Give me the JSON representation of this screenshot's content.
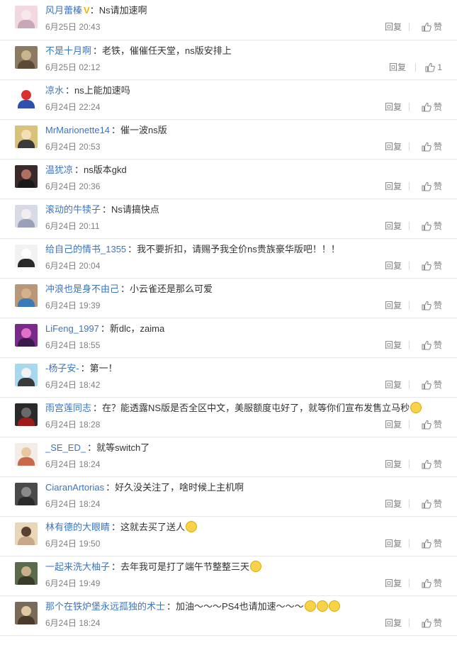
{
  "comments": [
    {
      "user": "风月蕾榛",
      "badge": "V",
      "text": "：Ns请加速啊",
      "emoji": 0,
      "time": "6月25日 20:43",
      "reply": "回复",
      "like": "赞",
      "wide": false,
      "avatar": [
        "#f3d8e0",
        "#f7e8ee",
        "#c8a8b8"
      ]
    },
    {
      "user": "不是十月啊",
      "badge": "",
      "text": "：老铁，催催任天堂，ns版安排上",
      "emoji": 0,
      "time": "6月25日 02:12",
      "reply": "回复",
      "like": "1",
      "wide": true,
      "avatar": [
        "#8c7a62",
        "#c9b58d",
        "#5c4a38"
      ]
    },
    {
      "user": "凉水",
      "badge": "",
      "text": "：ns上能加速吗",
      "emoji": 0,
      "time": "6月24日 22:24",
      "reply": "回复",
      "like": "赞",
      "wide": false,
      "avatar": [
        "#ffffff",
        "#d93030",
        "#3050b0"
      ]
    },
    {
      "user": "MrMarionette14",
      "badge": "",
      "text": "：催一波ns版",
      "emoji": 0,
      "time": "6月24日 20:53",
      "reply": "回复",
      "like": "赞",
      "wide": false,
      "avatar": [
        "#d9c27a",
        "#f0dfb8",
        "#3a3a3a"
      ]
    },
    {
      "user": "温犹凉",
      "badge": "",
      "text": "：ns版本gkd",
      "emoji": 0,
      "time": "6月24日 20:36",
      "reply": "回复",
      "like": "赞",
      "wide": false,
      "avatar": [
        "#3a2a2a",
        "#b07060",
        "#1a1a1a"
      ]
    },
    {
      "user": "滚动的牛犊子",
      "badge": "",
      "text": "：Ns请搞快点",
      "emoji": 0,
      "time": "6月24日 20:11",
      "reply": "回复",
      "like": "赞",
      "wide": false,
      "avatar": [
        "#d8dbe6",
        "#f4eef0",
        "#9aa0b8"
      ]
    },
    {
      "user": "给自己的情书_1355",
      "badge": "",
      "text": "：我不要折扣，请赐予我全价ns贵族豪华版吧！！！",
      "emoji": 0,
      "time": "6月24日 20:04",
      "reply": "回复",
      "like": "赞",
      "wide": false,
      "avatar": [
        "#f2f2f2",
        "#ffffff",
        "#2a2a2a"
      ]
    },
    {
      "user": "冲浪也是身不由己",
      "badge": "",
      "text": "：小云雀还是那么可爱",
      "emoji": 0,
      "time": "6月24日 19:39",
      "reply": "回复",
      "like": "赞",
      "wide": false,
      "avatar": [
        "#b89878",
        "#d6b08a",
        "#3a7ab8"
      ]
    },
    {
      "user": "LiFeng_1997",
      "badge": "",
      "text": "：新dlc，zaima",
      "emoji": 0,
      "time": "6月24日 18:55",
      "reply": "回复",
      "like": "赞",
      "wide": false,
      "avatar": [
        "#7a2a8a",
        "#e070c8",
        "#3a1a4a"
      ]
    },
    {
      "user": "-杨子安-",
      "badge": "",
      "text": "：第一！",
      "emoji": 0,
      "time": "6月24日 18:42",
      "reply": "回复",
      "like": "赞",
      "wide": false,
      "avatar": [
        "#a8d8f0",
        "#f2f2f2",
        "#3a3a3a"
      ]
    },
    {
      "user": "雨宫莲同志",
      "badge": "",
      "text": "：在？能透露NS版是否全区中文，美服额度屯好了，就等你们宣布发售立马秒",
      "emoji": 1,
      "time": "6月24日 18:28",
      "reply": "回复",
      "like": "赞",
      "wide": false,
      "avatar": [
        "#2a2a2a",
        "#6a6a6a",
        "#a01a1a"
      ]
    },
    {
      "user": "_SE_ED_",
      "badge": "",
      "text": "：就等switch了",
      "emoji": 0,
      "time": "6月24日 18:24",
      "reply": "回复",
      "like": "赞",
      "wide": false,
      "avatar": [
        "#f2ede6",
        "#e8c8a0",
        "#c86a4a"
      ]
    },
    {
      "user": "CiaranArtorias",
      "badge": "",
      "text": "：好久没关注了，啥时候上主机啊",
      "emoji": 0,
      "time": "6月24日 18:24",
      "reply": "回复",
      "like": "赞",
      "wide": false,
      "avatar": [
        "#4a4a4a",
        "#8a8a8a",
        "#2a2a2a"
      ]
    },
    {
      "user": "林有德的大眼睛",
      "badge": "",
      "text": "：这就去买了送人",
      "emoji": 1,
      "time": "6月24日 19:50",
      "reply": "回复",
      "like": "赞",
      "wide": false,
      "avatar": [
        "#e8d8b8",
        "#5a4030",
        "#c8a888"
      ]
    },
    {
      "user": "一起来洗大柚子",
      "badge": "",
      "text": "：去年我可是打了端午节整整三天",
      "emoji": 1,
      "time": "6月24日 19:49",
      "reply": "回复",
      "like": "赞",
      "wide": false,
      "avatar": [
        "#5a6a4a",
        "#c8b08a",
        "#3a3a2a"
      ]
    },
    {
      "user": "那个在铁炉堡永远孤独的术士",
      "badge": "",
      "text": "：加油～～～PS4也请加速～～～",
      "emoji": 3,
      "time": "6月24日 18:24",
      "reply": "回复",
      "like": "赞",
      "wide": false,
      "avatar": [
        "#7a6a5a",
        "#e0c8a0",
        "#4a3a2a"
      ]
    }
  ]
}
